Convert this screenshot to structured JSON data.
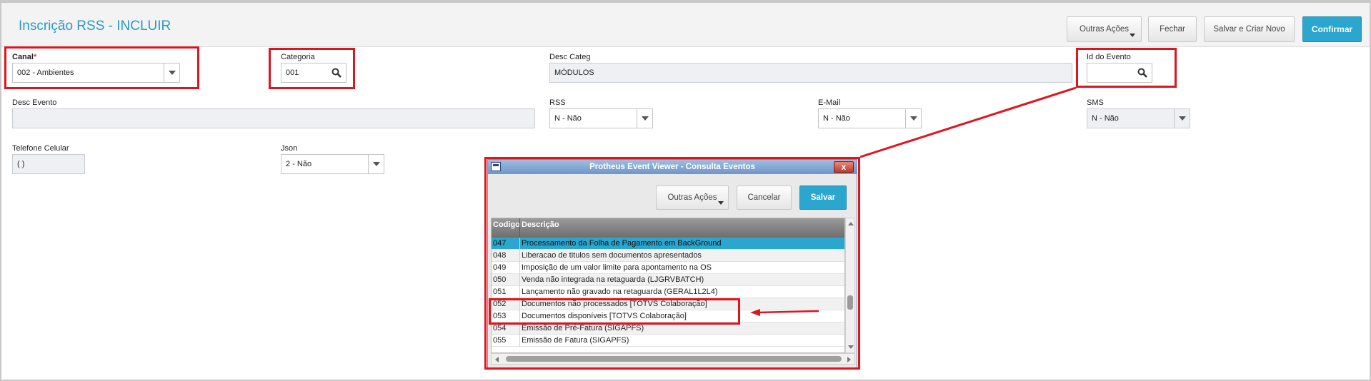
{
  "page": {
    "title": "Inscrição RSS - INCLUIR",
    "buttons": {
      "outras_acoes": "Outras Ações",
      "fechar": "Fechar",
      "salvar_criar": "Salvar e Criar Novo",
      "confirmar": "Confirmar"
    }
  },
  "form": {
    "canal": {
      "label": "Canal",
      "required_mark": "*",
      "value": "002 - Ambientes"
    },
    "categoria": {
      "label": "Categoria",
      "value": "001"
    },
    "desc_categ": {
      "label": "Desc Categ",
      "value": "MÓDULOS"
    },
    "id_evento": {
      "label": "Id do Evento",
      "value": ""
    },
    "desc_evento": {
      "label": "Desc Evento",
      "value": ""
    },
    "rss": {
      "label": "RSS",
      "value": "N - Não"
    },
    "email": {
      "label": "E-Mail",
      "value": "N - Não"
    },
    "sms": {
      "label": "SMS",
      "value": "N - Não"
    },
    "telefone": {
      "label": "Telefone Celular",
      "value": "(  )"
    },
    "json": {
      "label": "Json",
      "value": "2 - Não"
    }
  },
  "dialog": {
    "title": "Protheus Event Viewer - Consulta Eventos",
    "close_label": "x",
    "buttons": {
      "outras_acoes": "Outras Ações",
      "cancelar": "Cancelar",
      "salvar": "Salvar"
    },
    "columns": [
      "Codigo",
      "Descrição"
    ],
    "rows": [
      {
        "code": "047",
        "desc": "Processamento da Folha de Pagamento em BackGround",
        "selected": true
      },
      {
        "code": "048",
        "desc": "Liberacao de titulos sem documentos apresentados"
      },
      {
        "code": "049",
        "desc": "Imposição de um valor limite para apontamento na OS"
      },
      {
        "code": "050",
        "desc": "Venda não integrada na retaguarda (LJGRVBATCH)"
      },
      {
        "code": "051",
        "desc": "Lançamento não gravado na retaguarda (GERAL1L2L4)"
      },
      {
        "code": "052",
        "desc": "Documentos não processados [TOTVS Colaboração]"
      },
      {
        "code": "053",
        "desc": "Documentos disponíveis [TOTVS Colaboração]"
      },
      {
        "code": "054",
        "desc": "Emissão de Pré-Fatura (SIGAPFS)"
      },
      {
        "code": "055",
        "desc": "Emissão de Fatura (SIGAPFS)"
      }
    ]
  },
  "colors": {
    "accent": "#2aa6cf",
    "title": "#2b98c9",
    "annotation": "#e0141e"
  }
}
